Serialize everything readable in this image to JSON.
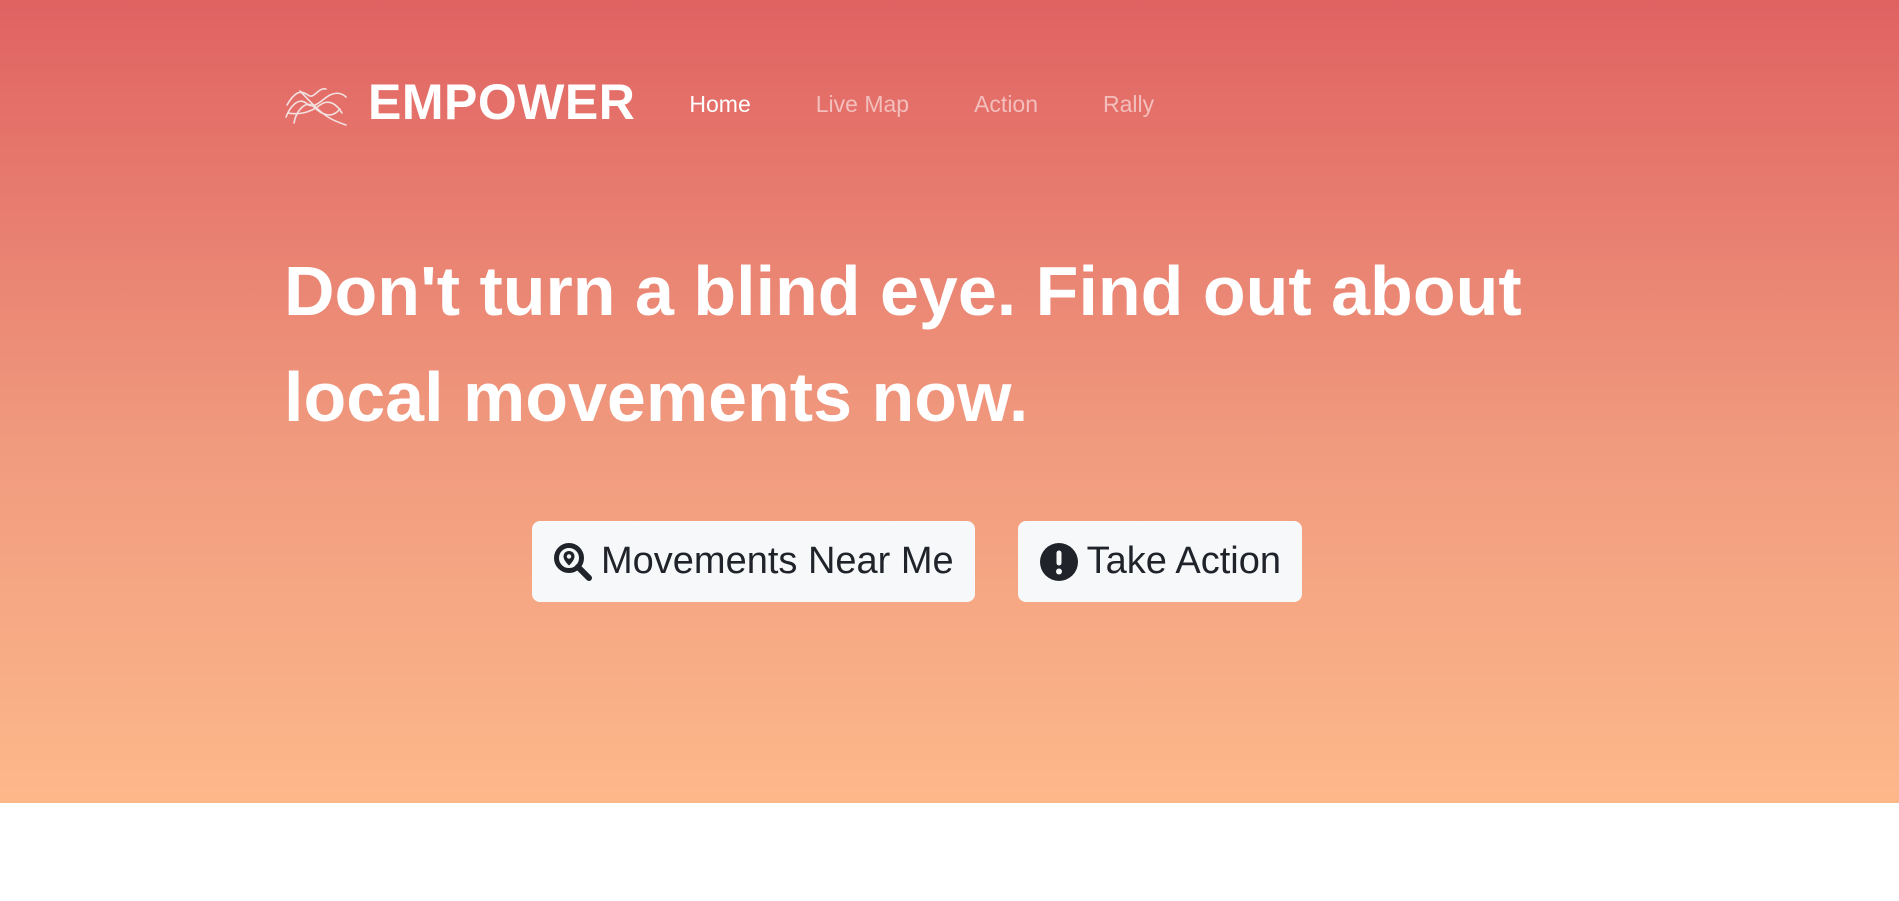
{
  "brand": {
    "name": "EMPOWER",
    "logo_icon": "scribble-logo-icon"
  },
  "nav": {
    "items": [
      {
        "label": "Home",
        "active": true
      },
      {
        "label": "Live Map",
        "active": false
      },
      {
        "label": "Action",
        "active": false
      },
      {
        "label": "Rally",
        "active": false
      }
    ]
  },
  "hero": {
    "headline": "Don't turn a blind eye. Find out about local movements now.",
    "buttons": [
      {
        "label": "Movements Near Me",
        "icon": "search-location-icon"
      },
      {
        "label": "Take Action",
        "icon": "exclamation-circle-icon"
      }
    ]
  },
  "colors": {
    "gradient_top": "#e06262",
    "gradient_bottom": "#fdb88a",
    "button_bg": "#f7f8fa",
    "button_text": "#20242a"
  }
}
